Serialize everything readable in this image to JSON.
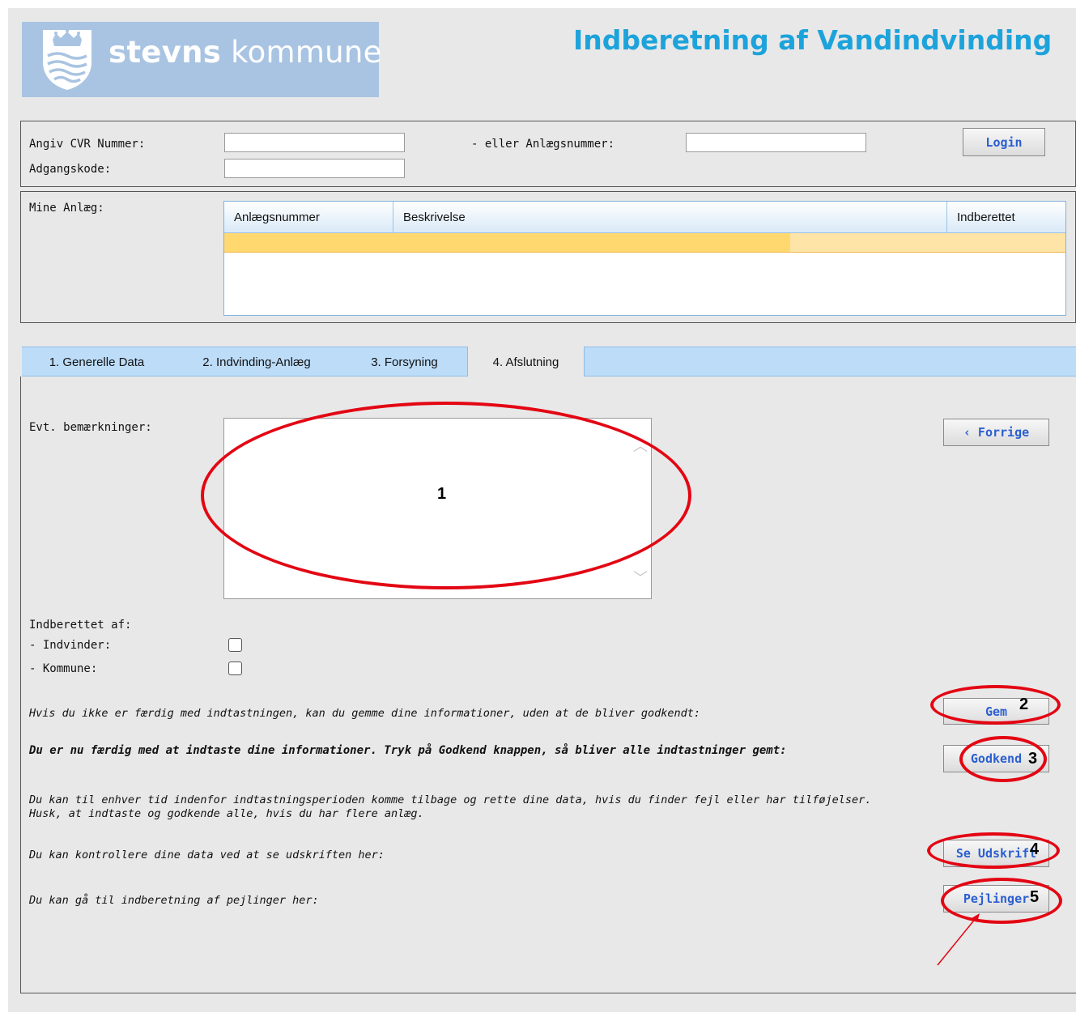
{
  "header": {
    "brand_bold": "stevns",
    "brand_light": "kommune",
    "title": "Indberetning af Vandindvinding"
  },
  "login": {
    "cvr_label": "Angiv CVR Nummer:",
    "or_label": "- eller Anlægsnummer:",
    "password_label": "Adgangskode:",
    "button": "Login"
  },
  "facilities": {
    "label": "Mine Anlæg:",
    "columns": [
      "Anlægsnummer",
      "Beskrivelse",
      "Indberettet"
    ]
  },
  "tabs": [
    {
      "label": "1. Generelle Data"
    },
    {
      "label": "2. Indvinding-Anlæg"
    },
    {
      "label": "3. Forsyning"
    },
    {
      "label": "4. Afslutning",
      "active": true
    }
  ],
  "form": {
    "remarks_label": "Evt. bemærkninger:",
    "prev_button": "‹ Forrige",
    "reported_by_label": "Indberettet af:",
    "reporter_options": [
      {
        "label": "- Indvinder:",
        "checked": false
      },
      {
        "label": "- Kommune:",
        "checked": false
      }
    ],
    "save_text": "Hvis du ikke er færdig med indtastningen, kan du gemme dine informationer, uden at de bliver godkendt:",
    "save_button": "Gem",
    "approve_text": "Du er nu færdig med at indtaste dine informationer. Tryk på Godkend knappen, så bliver alle indtastninger gemt:",
    "approve_button": "Godkend",
    "info_line1": "Du kan til enhver tid indenfor indtastningsperioden komme tilbage og rette dine data, hvis du finder fejl eller har tilføjelser.",
    "info_line2": "Husk, at indtaste og godkende alle, hvis du har flere anlæg.",
    "print_text": "Du kan kontrollere dine data ved at se udskriften her:",
    "print_button": "Se Udskrift",
    "soundings_text": "Du kan gå til indberetning af pejlinger her:",
    "soundings_button": "Pejlinger"
  },
  "annotations": {
    "markers": [
      "1",
      "2",
      "3",
      "4",
      "5"
    ],
    "color": "#e30613"
  },
  "colors": {
    "title": "#1da3db",
    "button_text": "#2b5fd1",
    "logo_bg": "#a9c4e2",
    "tab_bar": "#bcdcf8",
    "selected_row": "#ffd970"
  }
}
